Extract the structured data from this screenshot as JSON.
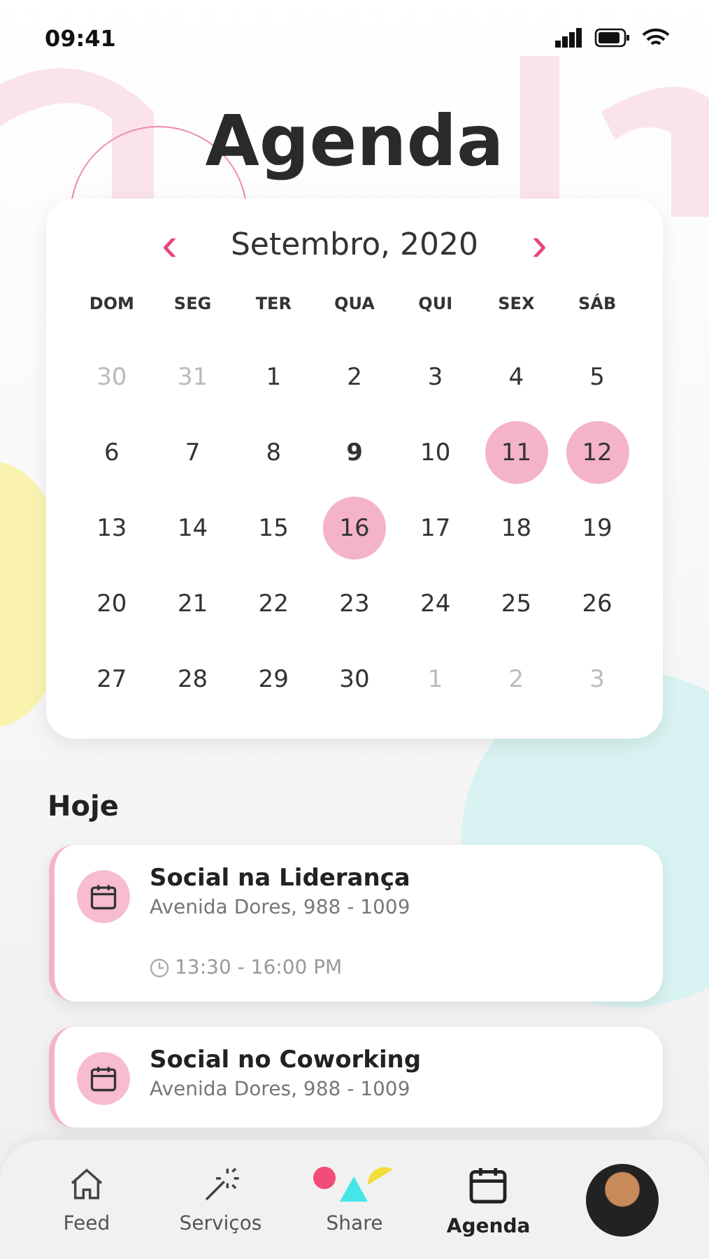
{
  "status_bar": {
    "time": "09:41"
  },
  "title": "Agenda",
  "calendar": {
    "month": "Setembro, 2020",
    "prev": "‹",
    "next": "›",
    "weekdays": [
      "DOM",
      "SEG",
      "TER",
      "QUA",
      "QUI",
      "SEX",
      "SÁB"
    ],
    "days": [
      {
        "label": "30",
        "outside": true,
        "today": false,
        "selected": false
      },
      {
        "label": "31",
        "outside": true,
        "today": false,
        "selected": false
      },
      {
        "label": "1",
        "outside": false,
        "today": false,
        "selected": false
      },
      {
        "label": "2",
        "outside": false,
        "today": false,
        "selected": false
      },
      {
        "label": "3",
        "outside": false,
        "today": false,
        "selected": false
      },
      {
        "label": "4",
        "outside": false,
        "today": false,
        "selected": false
      },
      {
        "label": "5",
        "outside": false,
        "today": false,
        "selected": false
      },
      {
        "label": "6",
        "outside": false,
        "today": false,
        "selected": false
      },
      {
        "label": "7",
        "outside": false,
        "today": false,
        "selected": false
      },
      {
        "label": "8",
        "outside": false,
        "today": false,
        "selected": false
      },
      {
        "label": "9",
        "outside": false,
        "today": true,
        "selected": false
      },
      {
        "label": "10",
        "outside": false,
        "today": false,
        "selected": false
      },
      {
        "label": "11",
        "outside": false,
        "today": false,
        "selected": true
      },
      {
        "label": "12",
        "outside": false,
        "today": false,
        "selected": true
      },
      {
        "label": "13",
        "outside": false,
        "today": false,
        "selected": false
      },
      {
        "label": "14",
        "outside": false,
        "today": false,
        "selected": false
      },
      {
        "label": "15",
        "outside": false,
        "today": false,
        "selected": false
      },
      {
        "label": "16",
        "outside": false,
        "today": false,
        "selected": true
      },
      {
        "label": "17",
        "outside": false,
        "today": false,
        "selected": false
      },
      {
        "label": "18",
        "outside": false,
        "today": false,
        "selected": false
      },
      {
        "label": "19",
        "outside": false,
        "today": false,
        "selected": false
      },
      {
        "label": "20",
        "outside": false,
        "today": false,
        "selected": false
      },
      {
        "label": "21",
        "outside": false,
        "today": false,
        "selected": false
      },
      {
        "label": "22",
        "outside": false,
        "today": false,
        "selected": false
      },
      {
        "label": "23",
        "outside": false,
        "today": false,
        "selected": false
      },
      {
        "label": "24",
        "outside": false,
        "today": false,
        "selected": false
      },
      {
        "label": "25",
        "outside": false,
        "today": false,
        "selected": false
      },
      {
        "label": "26",
        "outside": false,
        "today": false,
        "selected": false
      },
      {
        "label": "27",
        "outside": false,
        "today": false,
        "selected": false
      },
      {
        "label": "28",
        "outside": false,
        "today": false,
        "selected": false
      },
      {
        "label": "29",
        "outside": false,
        "today": false,
        "selected": false
      },
      {
        "label": "30",
        "outside": false,
        "today": false,
        "selected": false
      },
      {
        "label": "1",
        "outside": true,
        "today": false,
        "selected": false
      },
      {
        "label": "2",
        "outside": true,
        "today": false,
        "selected": false
      },
      {
        "label": "3",
        "outside": true,
        "today": false,
        "selected": false
      }
    ]
  },
  "section_title": "Hoje",
  "events": [
    {
      "title": "Social na Liderança",
      "address": "Avenida Dores, 988 - 1009",
      "time": "13:30 - 16:00 PM"
    },
    {
      "title": "Social no Coworking",
      "address": "Avenida Dores, 988 - 1009"
    }
  ],
  "nav": [
    {
      "label": "Feed",
      "kind": "home",
      "selected": false
    },
    {
      "label": "Serviços",
      "kind": "wand",
      "selected": false
    },
    {
      "label": "Share",
      "kind": "shapes",
      "selected": false
    },
    {
      "label": "Agenda",
      "kind": "calendar",
      "selected": true
    },
    {
      "kind": "avatar",
      "selected": false
    }
  ]
}
